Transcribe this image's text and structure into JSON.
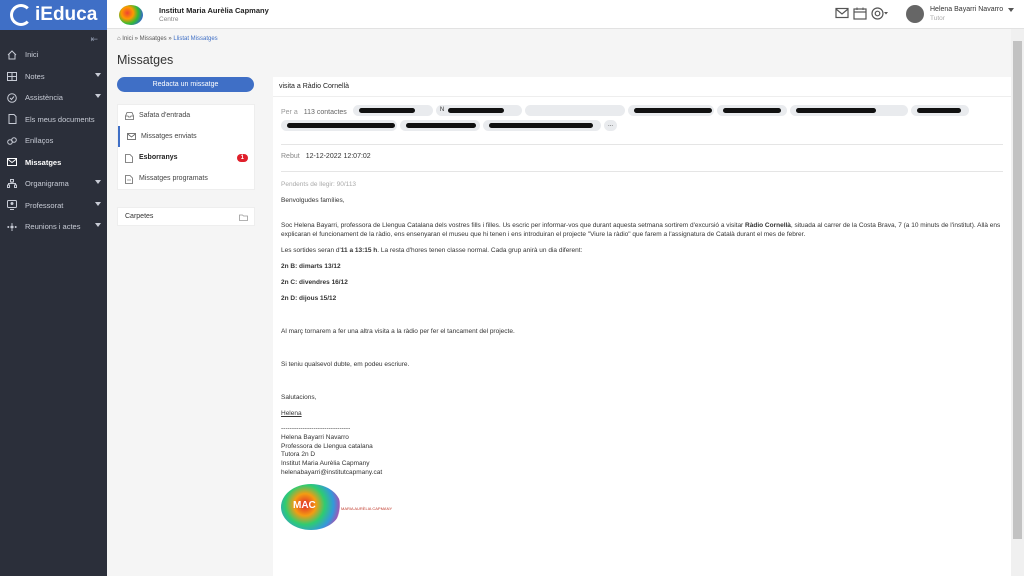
{
  "app": {
    "name": "iEduca"
  },
  "sidebar": {
    "items": [
      {
        "label": "Inici",
        "icon": "home-icon"
      },
      {
        "label": "Notes",
        "icon": "grid-icon",
        "arrow": true
      },
      {
        "label": "Assistència",
        "icon": "check-circle-icon",
        "arrow": true
      },
      {
        "label": "Els meus documents",
        "icon": "document-icon"
      },
      {
        "label": "Enllaços",
        "icon": "link-icon"
      },
      {
        "label": "Missatges",
        "icon": "envelope-icon",
        "active": true
      },
      {
        "label": "Organigrama",
        "icon": "org-chart-icon",
        "arrow": true
      },
      {
        "label": "Professorat",
        "icon": "teacher-icon",
        "arrow": true
      },
      {
        "label": "Reunions i actes",
        "icon": "meeting-icon",
        "arrow": true
      }
    ]
  },
  "header": {
    "school_name": "Institut Maria Aurèlia Capmany",
    "school_sub": "Centre",
    "user_name": "Helena Bayarri Navarro",
    "user_role": "Tutor"
  },
  "breadcrumb": {
    "home": "Inici",
    "sep1": " » ",
    "missatges": "Missatges",
    "sep2": " » ",
    "current": "Llistat Missatges"
  },
  "page_title": "Missatges",
  "compose_label": "Redacta un missatge",
  "folders": [
    {
      "label": "Safata d'entrada",
      "icon": "inbox-icon"
    },
    {
      "label": "Missatges enviats",
      "icon": "envelope-icon",
      "selected": true
    },
    {
      "label": "Esborranys",
      "icon": "draft-icon",
      "bold": true,
      "badge": "1"
    },
    {
      "label": "Missatges programats",
      "icon": "scheduled-icon"
    }
  ],
  "carpetes_label": "Carpetes",
  "message": {
    "subject": "visita a Ràdio Cornellà",
    "per_label": "Per a",
    "recipients_count": "113 contactes",
    "chip_prefixes": [
      "",
      "N",
      "",
      "",
      "",
      "",
      "",
      "",
      "",
      "",
      "",
      ""
    ],
    "more_label": "...",
    "received_label": "Rebut",
    "received_date": "12-12-2022 12:07:02",
    "pending": "Pendents de llegir: 90/113",
    "greeting": "Benvolgudes famílies,",
    "p1a": "Soc Helena Bayarri, professora de Llengua Catalana dels vostres fills i filles. Us escric per informar-vos que durant aquesta setmana sortirem d'excursió a visitar ",
    "p1b": "Ràdio Cornellà",
    "p1c": ", situada al carrer de la Costa Brava, 7 (a 10 minuts de l'institut). Allà ens explicaran el funcionament de la ràdio, ens ensenyaran el museu que hi tenen i ens introduiran el projecte \"Viure la ràdio\" que farem a l'assignatura de Català durant el mes de febrer.",
    "p2a": "Les sortides seran d'",
    "p2b": "11 a 13:15 h",
    "p2c": ". La resta d'hores tenen classe normal. Cada grup anirà un dia diferent:",
    "g1": "2n B: dimarts 13/12",
    "g2": "2n C: divendres 16/12",
    "g3": "2n D: dijous 15/12",
    "p3": "Al març tornarem a fer una altra visita a la ràdio per fer el tancament del projecte.",
    "p4": "Si teniu qualsevol dubte, em podeu escriure.",
    "closing": "Salutacions,",
    "signature_name": "Helena",
    "sig_line": "--------------------------------",
    "sig1": "Helena Bayarri Navarro",
    "sig2": "Professora de Llengua catalana",
    "sig3": "Tutora 2n D",
    "sig4": "Institut Maria Aurèlia Capmany",
    "sig5": "helenabayarri@institutcapmany.cat",
    "logo_text": "MAC",
    "logo_tag": "MARIA AURÈLIA CAPMANY"
  }
}
